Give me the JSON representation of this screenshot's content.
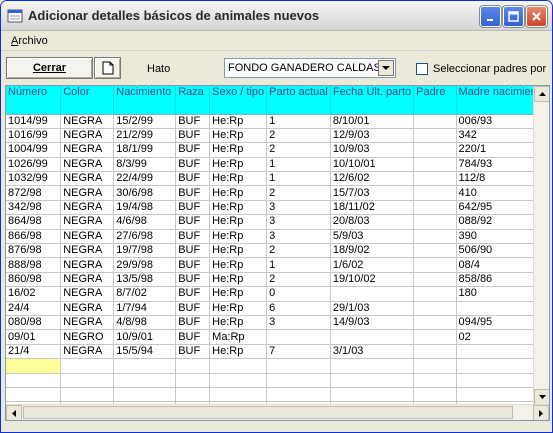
{
  "window": {
    "title": "Adicionar detalles básicos de animales nuevos"
  },
  "menu": {
    "archivo_first": "A",
    "archivo_rest": "rchivo"
  },
  "toolbar": {
    "cerrar_label": "Cerrar",
    "hato_label": "Hato",
    "hato_value": "FONDO GANADERO CALDAS",
    "seleccionar_label": "Seleccionar padres por"
  },
  "grid": {
    "headers": [
      "Número",
      "Color",
      "Nacimiento",
      "Raza",
      "Sexo / tipo",
      "Parto actual",
      "Fecha Ult. parto",
      "Padre",
      "Madre nacimiento"
    ],
    "rows": [
      [
        "1014/99",
        "NEGRA",
        "15/2/99",
        "BUF",
        "He:Rp",
        "1",
        "8/10/01",
        "",
        "006/93"
      ],
      [
        "1016/99",
        "NEGRA",
        "21/2/99",
        "BUF",
        "He:Rp",
        "2",
        "12/9/03",
        "",
        "342"
      ],
      [
        "1004/99",
        "NEGRA",
        "18/1/99",
        "BUF",
        "He:Rp",
        "2",
        "10/9/03",
        "",
        "220/1"
      ],
      [
        "1026/99",
        "NEGRA",
        "8/3/99",
        "BUF",
        "He:Rp",
        "1",
        "10/10/01",
        "",
        "784/93"
      ],
      [
        "1032/99",
        "NEGRA",
        "22/4/99",
        "BUF",
        "He:Rp",
        "1",
        "12/6/02",
        "",
        "112/8"
      ],
      [
        "872/98",
        "NEGRA",
        "30/6/98",
        "BUF",
        "He:Rp",
        "2",
        "15/7/03",
        "",
        "410"
      ],
      [
        "342/98",
        "NEGRA",
        "19/4/98",
        "BUF",
        "He:Rp",
        "3",
        "18/11/02",
        "",
        "642/95"
      ],
      [
        "864/98",
        "NEGRA",
        "4/6/98",
        "BUF",
        "He:Rp",
        "3",
        "20/8/03",
        "",
        "088/92"
      ],
      [
        "866/98",
        "NEGRA",
        "27/6/98",
        "BUF",
        "He:Rp",
        "3",
        "5/9/03",
        "",
        "390"
      ],
      [
        "876/98",
        "NEGRA",
        "19/7/98",
        "BUF",
        "He:Rp",
        "2",
        "18/9/02",
        "",
        "506/90"
      ],
      [
        "888/98",
        "NEGRA",
        "29/9/98",
        "BUF",
        "He:Rp",
        "1",
        "1/6/02",
        "",
        "08/4"
      ],
      [
        "860/98",
        "NEGRA",
        "13/5/98",
        "BUF",
        "He:Rp",
        "2",
        "19/10/02",
        "",
        "858/86"
      ],
      [
        "16/02",
        "NEGRA",
        "8/7/02",
        "BUF",
        "He:Rp",
        "0",
        "",
        "",
        "180"
      ],
      [
        "24/4",
        "NEGRA",
        "1/7/94",
        "BUF",
        "He:Rp",
        "6",
        "29/1/03",
        "",
        ""
      ],
      [
        "080/98",
        "NEGRA",
        "4/8/98",
        "BUF",
        "He:Rp",
        "3",
        "14/9/03",
        "",
        "094/95"
      ],
      [
        "09/01",
        "NEGRO",
        "10/9/01",
        "BUF",
        "Ma:Rp",
        "",
        "",
        "",
        "02"
      ],
      [
        "21/4",
        "NEGRA",
        "15/5/94",
        "BUF",
        "He:Rp",
        "7",
        "3/1/03",
        "",
        ""
      ]
    ],
    "empty_rows": 4
  },
  "colors": {
    "header_bg": "#00ffff",
    "current_cell": "#ffff99",
    "window_bg": "#ece9d8"
  },
  "icons": {
    "title": "app-icon",
    "new": "new-document-icon",
    "minimize": "minimize-icon",
    "maximize": "maximize-icon",
    "close": "close-icon"
  }
}
